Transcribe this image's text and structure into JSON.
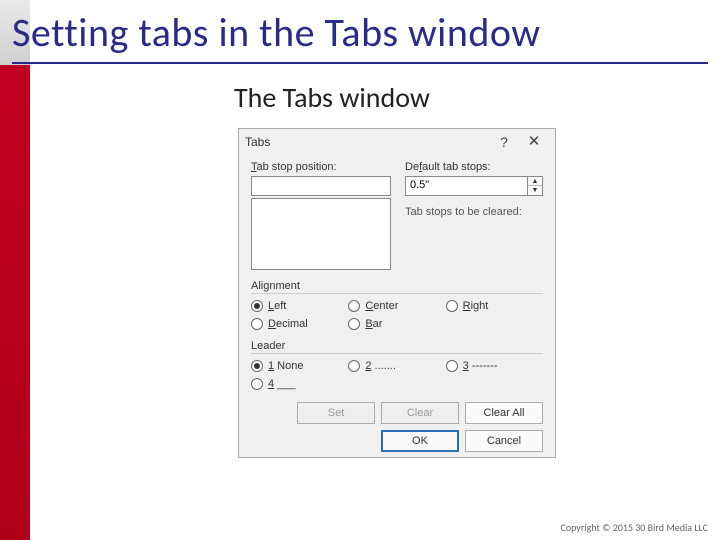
{
  "title": "Setting tabs in the Tabs window",
  "subtitle": "The Tabs window",
  "dialog": {
    "title": "Tabs",
    "help_glyph": "?",
    "close_glyph": "✕",
    "tab_stop_position_label_pre": "T",
    "tab_stop_position_label_post": "ab stop position:",
    "tab_stop_position_value": "",
    "default_tab_stops_label_pre": "De",
    "default_tab_stops_label_mid": "f",
    "default_tab_stops_label_post": "ault tab stops:",
    "default_tab_stops_value": "0.5\"",
    "clear_hint": "Tab stops to be cleared:",
    "alignment_label": "Alignment",
    "alignment": {
      "left_pre": "L",
      "left_post": "eft",
      "center_pre": "C",
      "center_post": "enter",
      "right_pre": "R",
      "right_post": "ight",
      "decimal_pre": "D",
      "decimal_post": "ecimal",
      "bar_pre": "B",
      "bar_post": "ar"
    },
    "leader_label": "Leader",
    "leader": {
      "opt1_pre": "1",
      "opt1_post": " None",
      "opt2_pre": "2",
      "opt2_post": " .......",
      "opt3_pre": "3",
      "opt3_post": " -------",
      "opt4_pre": "4",
      "opt4_post": " ___"
    },
    "buttons": {
      "set": "Set",
      "clear": "Clear",
      "clear_all": "Clear All",
      "ok": "OK",
      "cancel": "Cancel"
    }
  },
  "copyright": "Copyright © 2015 30 Bird Media LLC"
}
